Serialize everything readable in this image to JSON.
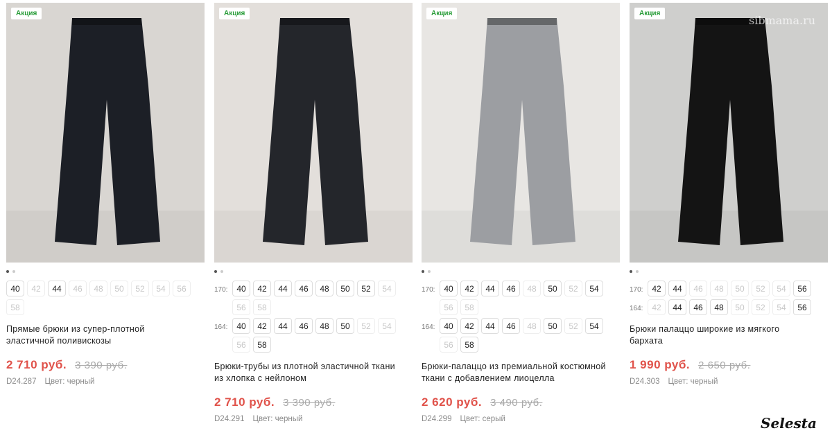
{
  "watermark": {
    "site": "sibmama.ru",
    "brand": "Selesta"
  },
  "products": [
    {
      "badge": "Акция",
      "image_label": "Прямые брюки — фото",
      "pant_color": "#1c1f26",
      "bg_color": "#d9d6d2",
      "title_line1": "Прямые брюки из супер-плотной",
      "title_line2": "эластичной поливискозы",
      "price": "2 710 руб.",
      "old_price": "3 390 руб.",
      "sku": "D24.287",
      "color": "Цвет: черный",
      "size_rows": [
        {
          "height": "",
          "sizes": [
            {
              "v": "40",
              "on": true
            },
            {
              "v": "42",
              "on": false
            },
            {
              "v": "44",
              "on": true
            },
            {
              "v": "46",
              "on": false
            },
            {
              "v": "48",
              "on": false
            },
            {
              "v": "50",
              "on": false
            },
            {
              "v": "52",
              "on": false
            },
            {
              "v": "54",
              "on": false
            },
            {
              "v": "56",
              "on": false
            },
            {
              "v": "58",
              "on": false
            }
          ]
        }
      ]
    },
    {
      "badge": "Акция",
      "image_label": "Брюки-трубы — фото",
      "pant_color": "#24262b",
      "bg_color": "#e3dfdb",
      "title_line1": "Брюки-трубы из плотной эластичной ткани",
      "title_line2": "из хлопка с нейлоном",
      "price": "2 710 руб.",
      "old_price": "3 390 руб.",
      "sku": "D24.291",
      "color": "Цвет: черный",
      "size_rows": [
        {
          "height": "170:",
          "sizes": [
            {
              "v": "40",
              "on": true
            },
            {
              "v": "42",
              "on": true
            },
            {
              "v": "44",
              "on": true
            },
            {
              "v": "46",
              "on": true
            },
            {
              "v": "48",
              "on": true
            },
            {
              "v": "50",
              "on": true
            },
            {
              "v": "52",
              "on": true
            },
            {
              "v": "54",
              "on": false
            },
            {
              "v": "56",
              "on": false
            },
            {
              "v": "58",
              "on": false
            }
          ]
        },
        {
          "height": "164:",
          "sizes": [
            {
              "v": "40",
              "on": true
            },
            {
              "v": "42",
              "on": true
            },
            {
              "v": "44",
              "on": true
            },
            {
              "v": "46",
              "on": true
            },
            {
              "v": "48",
              "on": true
            },
            {
              "v": "50",
              "on": true
            },
            {
              "v": "52",
              "on": false
            },
            {
              "v": "54",
              "on": false
            },
            {
              "v": "56",
              "on": false
            },
            {
              "v": "58",
              "on": true
            }
          ]
        }
      ]
    },
    {
      "badge": "Акция",
      "image_label": "Брюки-палаццо — фото",
      "pant_color": "#9c9ea2",
      "bg_color": "#e8e6e3",
      "title_line1": "Брюки-палаццо из премиальной костюмной",
      "title_line2": "ткани с добавлением лиоцелла",
      "price": "2 620 руб.",
      "old_price": "3 490 руб.",
      "sku": "D24.299",
      "color": "Цвет: серый",
      "size_rows": [
        {
          "height": "170:",
          "sizes": [
            {
              "v": "40",
              "on": true
            },
            {
              "v": "42",
              "on": true
            },
            {
              "v": "44",
              "on": true
            },
            {
              "v": "46",
              "on": true
            },
            {
              "v": "48",
              "on": false
            },
            {
              "v": "50",
              "on": true
            },
            {
              "v": "52",
              "on": false
            },
            {
              "v": "54",
              "on": true
            },
            {
              "v": "56",
              "on": false
            },
            {
              "v": "58",
              "on": false
            }
          ]
        },
        {
          "height": "164:",
          "sizes": [
            {
              "v": "40",
              "on": true
            },
            {
              "v": "42",
              "on": true
            },
            {
              "v": "44",
              "on": true
            },
            {
              "v": "46",
              "on": true
            },
            {
              "v": "48",
              "on": false
            },
            {
              "v": "50",
              "on": true
            },
            {
              "v": "52",
              "on": false
            },
            {
              "v": "54",
              "on": true
            },
            {
              "v": "56",
              "on": false
            },
            {
              "v": "58",
              "on": true
            }
          ]
        }
      ]
    },
    {
      "badge": "Акция",
      "image_label": "Брюки палаццо бархат — фото",
      "pant_color": "#141414",
      "bg_color": "#cfcfcd",
      "title_line1": "Брюки палаццо широкие из мягкого",
      "title_line2": "бархата",
      "price": "1 990 руб.",
      "old_price": "2 650 руб.",
      "sku": "D24.303",
      "color": "Цвет: черный",
      "size_rows": [
        {
          "height": "170:",
          "sizes": [
            {
              "v": "42",
              "on": true
            },
            {
              "v": "44",
              "on": true
            },
            {
              "v": "46",
              "on": false
            },
            {
              "v": "48",
              "on": false
            },
            {
              "v": "50",
              "on": false
            },
            {
              "v": "52",
              "on": false
            },
            {
              "v": "54",
              "on": false
            },
            {
              "v": "56",
              "on": true
            }
          ]
        },
        {
          "height": "164:",
          "sizes": [
            {
              "v": "42",
              "on": false
            },
            {
              "v": "44",
              "on": true
            },
            {
              "v": "46",
              "on": true
            },
            {
              "v": "48",
              "on": true
            },
            {
              "v": "50",
              "on": false
            },
            {
              "v": "52",
              "on": false
            },
            {
              "v": "54",
              "on": false
            },
            {
              "v": "56",
              "on": true
            }
          ]
        }
      ]
    }
  ]
}
